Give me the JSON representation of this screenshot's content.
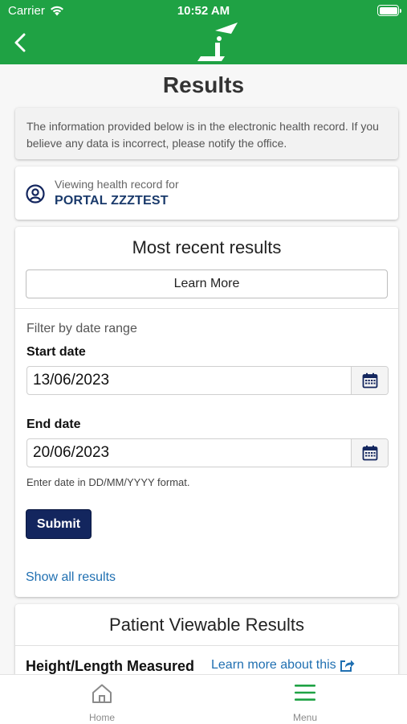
{
  "status_bar": {
    "carrier": "Carrier",
    "time": "10:52 AM"
  },
  "nav": {
    "back_icon": "chevron-left-icon",
    "logo_letter": "i"
  },
  "page": {
    "title": "Results"
  },
  "notice": {
    "text": "The information provided below is in the electronic health record. If you believe any data is incorrect, please notify the office."
  },
  "viewing": {
    "label": "Viewing health record for",
    "name": "PORTAL ZZZTEST"
  },
  "recent": {
    "title": "Most recent results",
    "learn_more": "Learn More",
    "filter_label": "Filter by date range",
    "start_label": "Start date",
    "start_value": "13/06/2023",
    "end_label": "End date",
    "end_value": "20/06/2023",
    "hint": "Enter date in DD/MM/YYYY format.",
    "submit": "Submit",
    "show_all": "Show all results"
  },
  "patient_viewable": {
    "title": "Patient Viewable Results",
    "row_title": "Height/Length Measured",
    "learn_link": "Learn more about this"
  },
  "tabbar": {
    "home": "Home",
    "menu": "Menu",
    "home_icon": "home-icon",
    "menu_icon": "hamburger-menu-icon",
    "active_color": "#1fa244"
  },
  "colors": {
    "brand_green": "#1fa244",
    "navy": "#13265e",
    "link": "#1f6fb1"
  }
}
